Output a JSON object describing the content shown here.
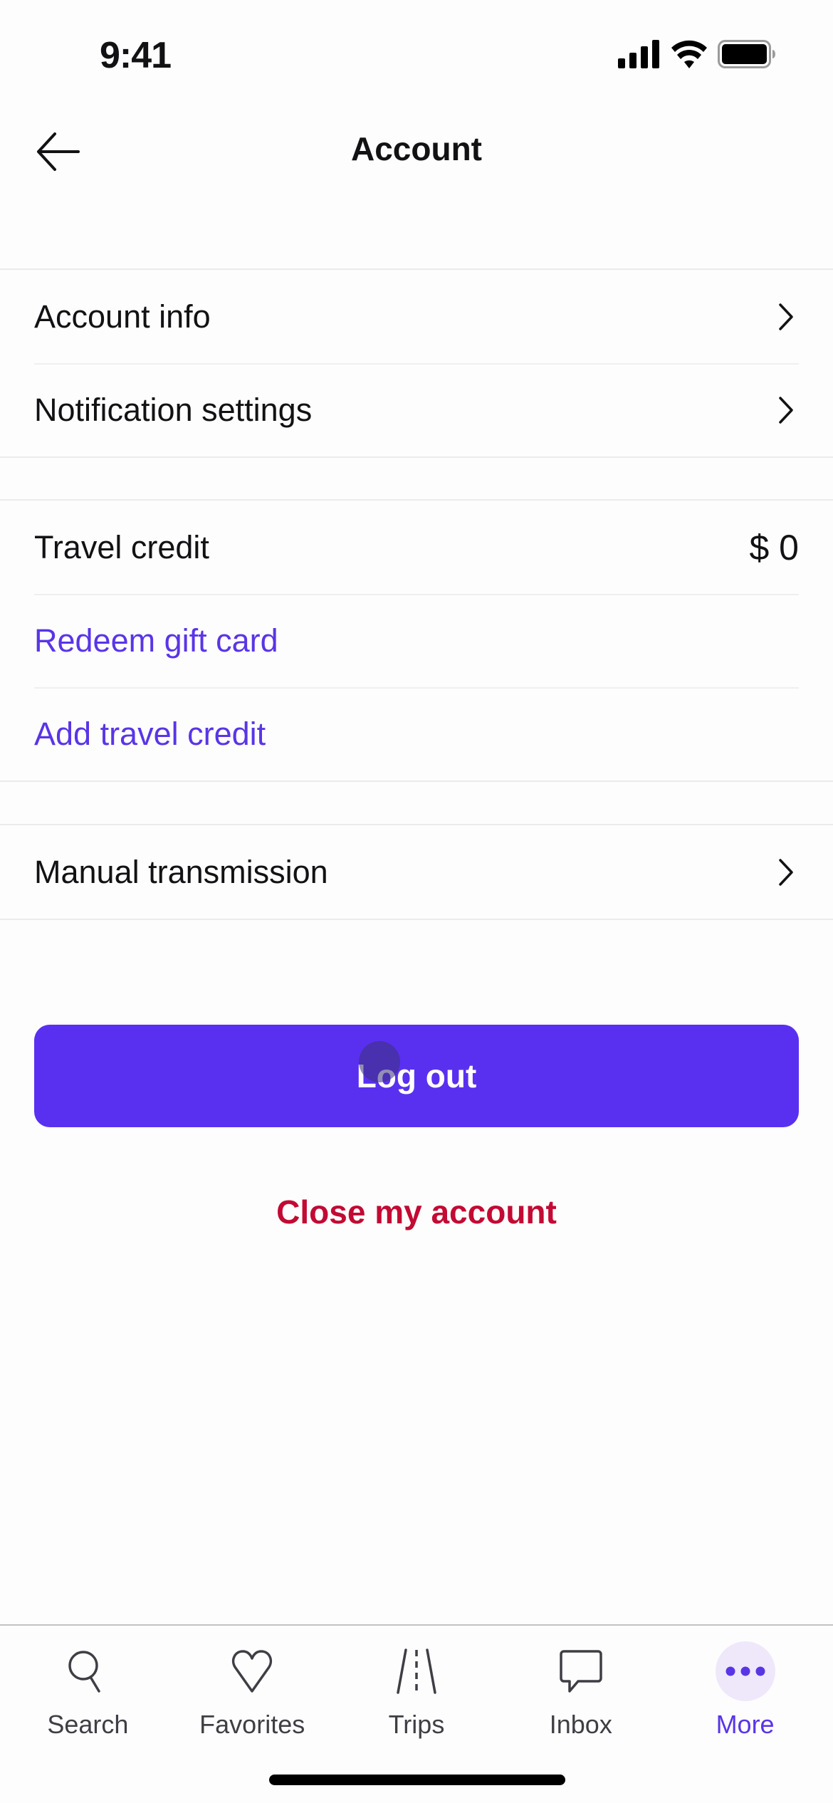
{
  "status_bar": {
    "time": "9:41",
    "icons": [
      "cellular-signal-icon",
      "wifi-icon",
      "battery-icon"
    ]
  },
  "header": {
    "back_icon": "arrow-left-icon",
    "title": "Account"
  },
  "sections": [
    {
      "rows": [
        {
          "label": "Account info",
          "type": "nav",
          "icon": "chevron-right-icon"
        },
        {
          "label": "Notification settings",
          "type": "nav",
          "icon": "chevron-right-icon"
        }
      ]
    },
    {
      "rows": [
        {
          "label": "Travel credit",
          "type": "value",
          "value": "$ 0"
        },
        {
          "label": "Redeem gift card",
          "type": "link"
        },
        {
          "label": "Add travel credit",
          "type": "link"
        }
      ]
    },
    {
      "rows": [
        {
          "label": "Manual transmission",
          "type": "nav",
          "icon": "chevron-right-icon"
        }
      ]
    }
  ],
  "actions": {
    "logout_label": "Log out",
    "close_account_label": "Close my account"
  },
  "tab_bar": {
    "items": [
      {
        "label": "Search",
        "icon": "search-icon",
        "active": false
      },
      {
        "label": "Favorites",
        "icon": "heart-icon",
        "active": false
      },
      {
        "label": "Trips",
        "icon": "road-icon",
        "active": false
      },
      {
        "label": "Inbox",
        "icon": "chat-bubble-icon",
        "active": false
      },
      {
        "label": "More",
        "icon": "more-dots-icon",
        "active": true
      }
    ]
  },
  "colors": {
    "accent": "#5935e6",
    "primary_button": "#5930f0",
    "danger": "#c20a33",
    "active_tab_bg": "#efe8fb"
  }
}
